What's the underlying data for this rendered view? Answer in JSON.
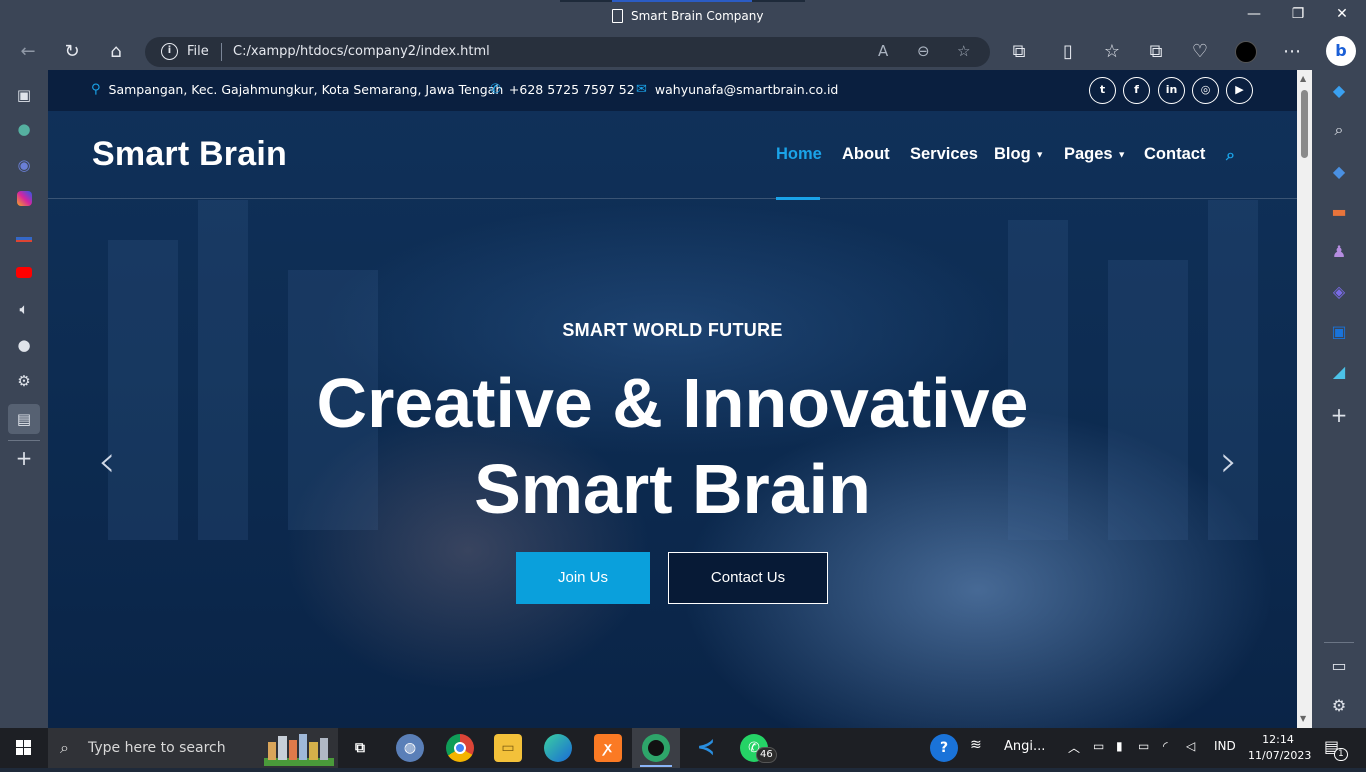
{
  "browser": {
    "window_title": "Smart Brain Company",
    "scheme_label": "File",
    "url": "C:/xampp/htdocs/company2/index.html"
  },
  "topbar": {
    "address": "Sampangan, Kec. Gajahmungkur, Kota Semarang, Jawa Tengah",
    "phone": "+628 5725 7597 52",
    "email": "wahyunafa@smartbrain.co.id",
    "social": [
      "twitter-icon",
      "facebook-icon",
      "linkedin-icon",
      "instagram-icon",
      "youtube-icon"
    ]
  },
  "nav": {
    "brand": "Smart Brain",
    "items": [
      {
        "label": "Home",
        "active": true
      },
      {
        "label": "About"
      },
      {
        "label": "Services"
      },
      {
        "label": "Blog",
        "dropdown": true
      },
      {
        "label": "Pages",
        "dropdown": true
      },
      {
        "label": "Contact"
      }
    ]
  },
  "hero": {
    "tagline": "SMART WORLD FUTURE",
    "headline_line1": "Creative & Innovative",
    "headline_line2": "Smart Brain",
    "primary_button": "Join Us",
    "secondary_button": "Contact Us",
    "prev_arrow": "‹",
    "next_arrow": "›"
  },
  "taskbar": {
    "search_placeholder": "Type here to search",
    "weather_text": "Angi...",
    "language": "IND",
    "time": "12:14",
    "date": "11/07/2023",
    "whatsapp_badge": "46",
    "notification_badge": "1"
  },
  "colors": {
    "accent": "#1aa3e8",
    "button_primary": "#0aa0dc",
    "topbar_bg": "#0a1f3f",
    "browser_chrome": "#3b4556",
    "taskbar_bg": "#1d1f24"
  }
}
